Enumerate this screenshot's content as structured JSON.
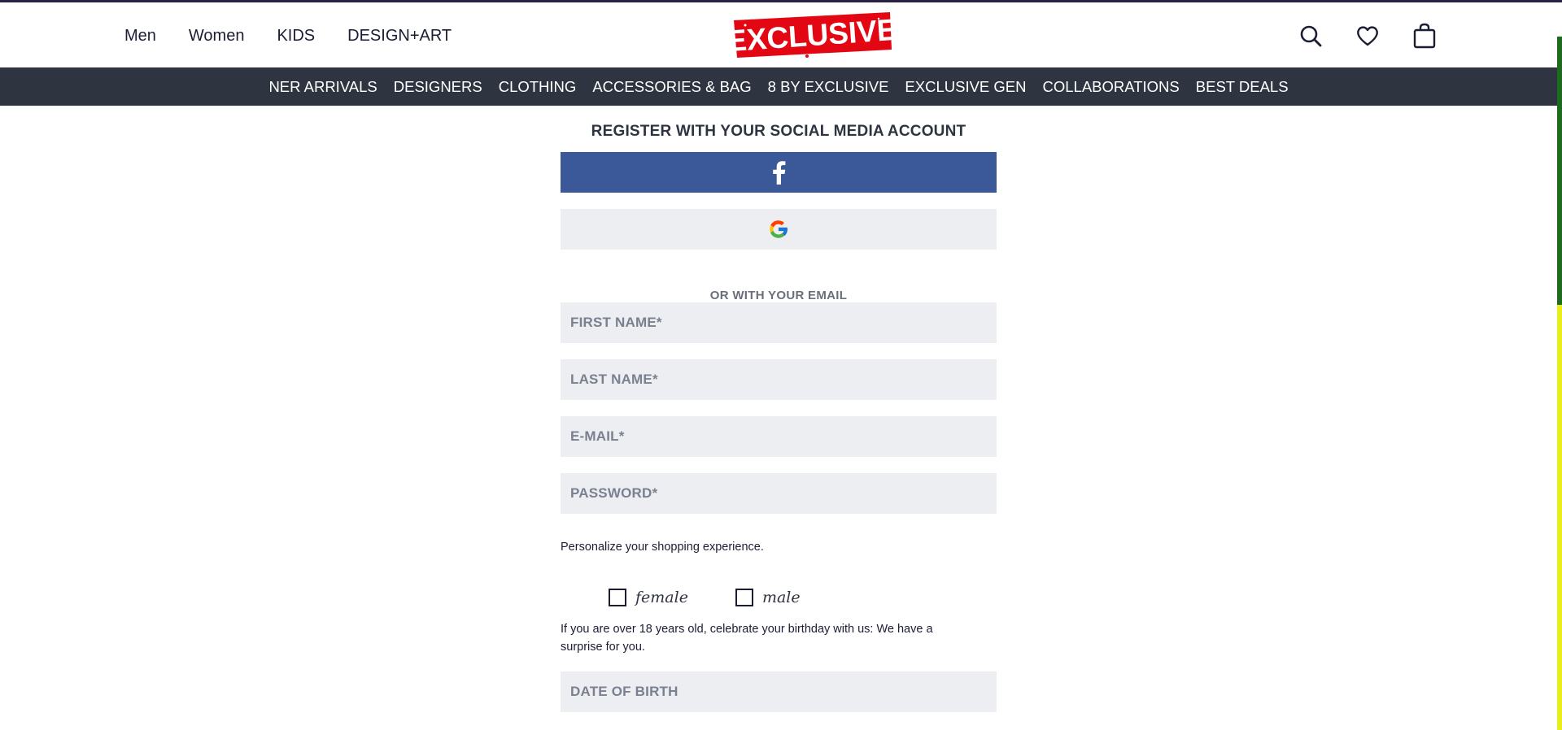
{
  "header": {
    "nav": [
      "Men",
      "Women",
      "KIDS",
      "DESIGN+ART"
    ],
    "logo_text": "EXCLUSIVE",
    "icons": [
      "search-icon",
      "heart-icon",
      "bag-icon"
    ]
  },
  "categories": [
    "NER ARRIVALS",
    "DESIGNERS",
    "CLOTHING",
    "ACCESSORIES & BAG",
    "8 BY EXCLUSIVE",
    "EXCLUSIVE GEN",
    "COLLABORATIONS",
    "BEST DEALS"
  ],
  "form": {
    "social_title": "REGISTER WITH YOUR SOCIAL MEDIA ACCOUNT",
    "or_email": "OR WITH YOUR EMAIL",
    "first_name_placeholder": "FIRST NAME*",
    "last_name_placeholder": "LAST NAME*",
    "email_placeholder": "E-MAIL*",
    "password_placeholder": "PASSWORD*",
    "personalize": "Personalize your shopping experience.",
    "female_label": "female",
    "male_label": "male",
    "birthday_text": "If you are over 18 years old, celebrate your birthday with us: We have a surprise for you.",
    "dob_placeholder": "DATE OF BIRTH"
  },
  "colors": {
    "category_bar": "#2e3440",
    "facebook": "#3b5998",
    "field_bg": "#eceef1",
    "logo_red": "#e30613"
  }
}
